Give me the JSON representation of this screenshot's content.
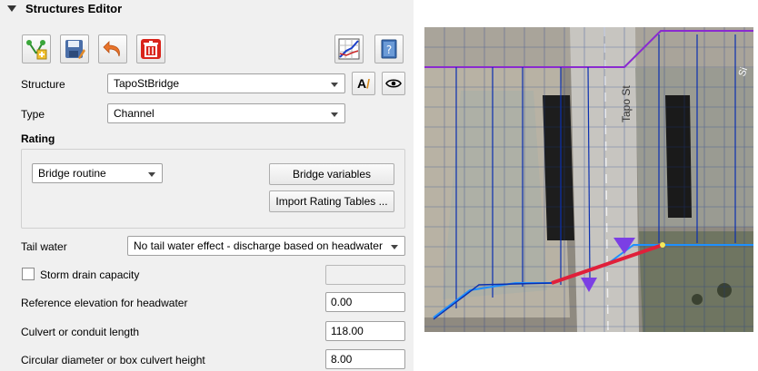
{
  "panel": {
    "title": "Structures Editor"
  },
  "toolbar": {
    "icons": [
      "add-structure-icon",
      "save-icon",
      "undo-icon",
      "delete-icon",
      "profile-plot-icon",
      "help-icon"
    ]
  },
  "structure": {
    "label": "Structure",
    "value": "TapoStBridge",
    "rename_label": "A"
  },
  "type": {
    "label": "Type",
    "value": "Channel"
  },
  "rating": {
    "heading": "Rating",
    "routine": "Bridge routine",
    "bridge_variables_button": "Bridge variables",
    "import_tables_button": "Import Rating Tables ..."
  },
  "tailwater": {
    "label": "Tail water",
    "value": "No tail water effect - discharge based on headwater"
  },
  "storm_drain": {
    "label": "Storm drain capacity",
    "checked": false,
    "value": ""
  },
  "reference_elevation": {
    "label": "Reference elevation for headwater",
    "value": "0.00"
  },
  "culvert_length": {
    "label": "Culvert or conduit length",
    "value": "118.00"
  },
  "culvert_height": {
    "label": "Circular diameter or box culvert height",
    "value": "8.00"
  },
  "map": {
    "street_label": "Tapo St",
    "edge_label": "Si",
    "colors": {
      "grid": "#0a2fb0",
      "boundary": "#8a2bd0",
      "channel": "#1e90ff",
      "structure": "#e0203a",
      "marker": "#7b3fe4"
    }
  }
}
